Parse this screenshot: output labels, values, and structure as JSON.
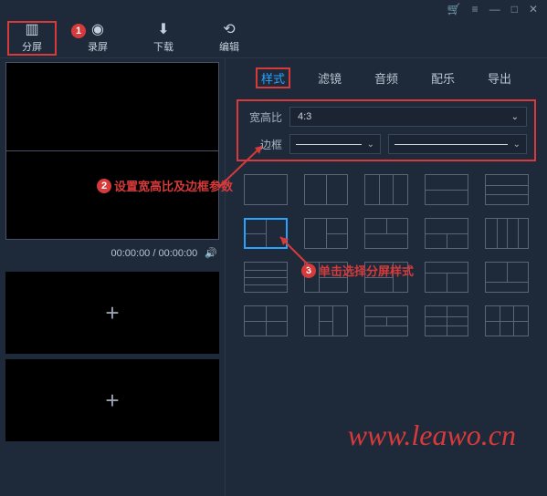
{
  "window": {
    "cart": "🛒",
    "list": "≡",
    "min": "—",
    "max": "□",
    "close": "✕"
  },
  "toolbar": {
    "split": "分屏",
    "record": "录屏",
    "download": "下载",
    "edit": "编辑"
  },
  "badges": {
    "b1": "1",
    "b2": "2",
    "b3": "3"
  },
  "timebar": {
    "time": "00:00:00 / 00:00:00"
  },
  "tabs": {
    "style": "样式",
    "filter": "滤镜",
    "audio": "音频",
    "music": "配乐",
    "export": "导出"
  },
  "options": {
    "ratio_label": "宽高比",
    "ratio_value": "4:3",
    "border_label": "边框"
  },
  "annotations": {
    "a2": "设置宽高比及边框参数",
    "a3": "单击选择分屏样式"
  },
  "watermark": "www.leawo.cn"
}
